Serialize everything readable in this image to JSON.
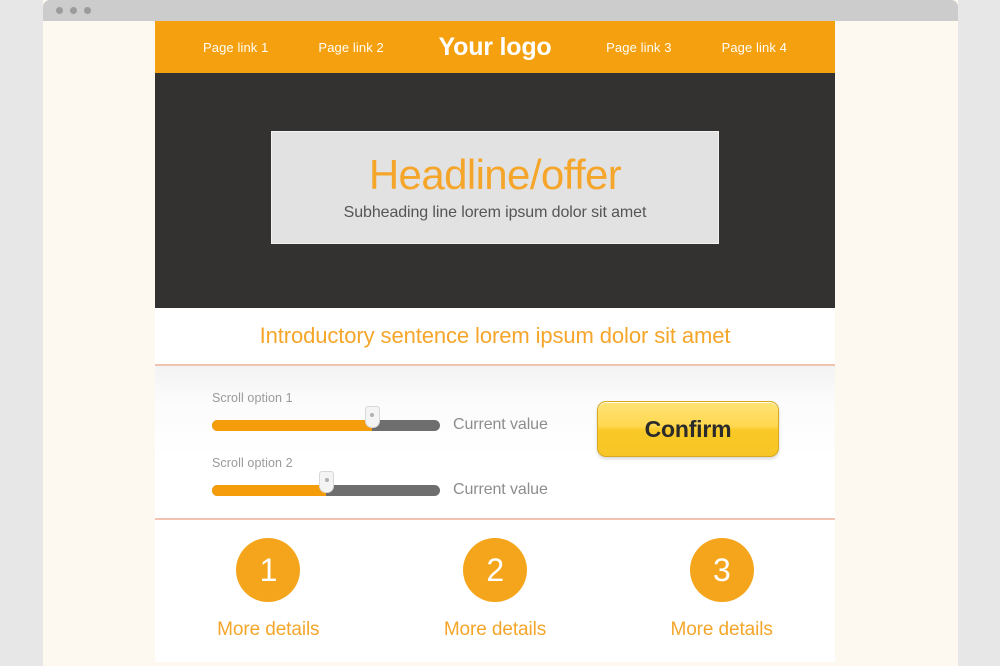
{
  "browser": {
    "dots": [
      "close-dot",
      "minimize-dot",
      "maximize-dot"
    ]
  },
  "nav": {
    "logo": "Your logo",
    "left_links": [
      "Page link 1",
      "Page link 2"
    ],
    "right_links": [
      "Page link 3",
      "Page link 4"
    ],
    "background_color": "#f5a00f",
    "text_color": "#ffffff"
  },
  "hero": {
    "background_color": "#333230",
    "card_background": "#e2e2e2",
    "headline": "Headline/offer",
    "subheading": "Subheading line lorem ipsum dolor sit amet",
    "headline_color": "#f5a62a"
  },
  "intro": {
    "sentence": "Introductory sentence lorem ipsum dolor sit amet",
    "color": "#f5a62a"
  },
  "controls": {
    "divider_color": "#f0c3b2",
    "sliders": [
      {
        "label": "Scroll option 1",
        "value_text": "Current value",
        "fill_percent": 70
      },
      {
        "label": "Scroll option 2",
        "value_text": "Current value",
        "fill_percent": 50
      }
    ],
    "confirm_label": "Confirm"
  },
  "steps": [
    {
      "number": "1",
      "label": "More details"
    },
    {
      "number": "2",
      "label": "More details"
    },
    {
      "number": "3",
      "label": "More details"
    }
  ],
  "theme": {
    "accent": "#f5a00f",
    "page_background": "#fdf9f0",
    "desktop_background": "#e7e7e7"
  }
}
